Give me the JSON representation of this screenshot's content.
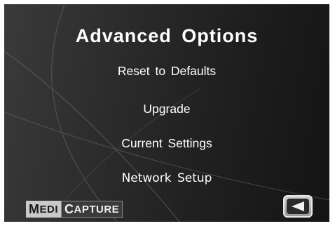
{
  "screen": {
    "title": "Advanced Options"
  },
  "menu": {
    "items": [
      {
        "label": "Reset to Defaults"
      },
      {
        "label": "Upgrade"
      },
      {
        "label": "Current Settings"
      },
      {
        "label": "Network Setup"
      }
    ]
  },
  "logo": {
    "part1_initial": "M",
    "part1_rest": "EDI",
    "part2_initial": "C",
    "part2_rest": "APTURE"
  },
  "back_button": {
    "icon": "left-arrow-icon"
  },
  "colors": {
    "background": "#2b2b2b",
    "text": "#ffffff"
  }
}
